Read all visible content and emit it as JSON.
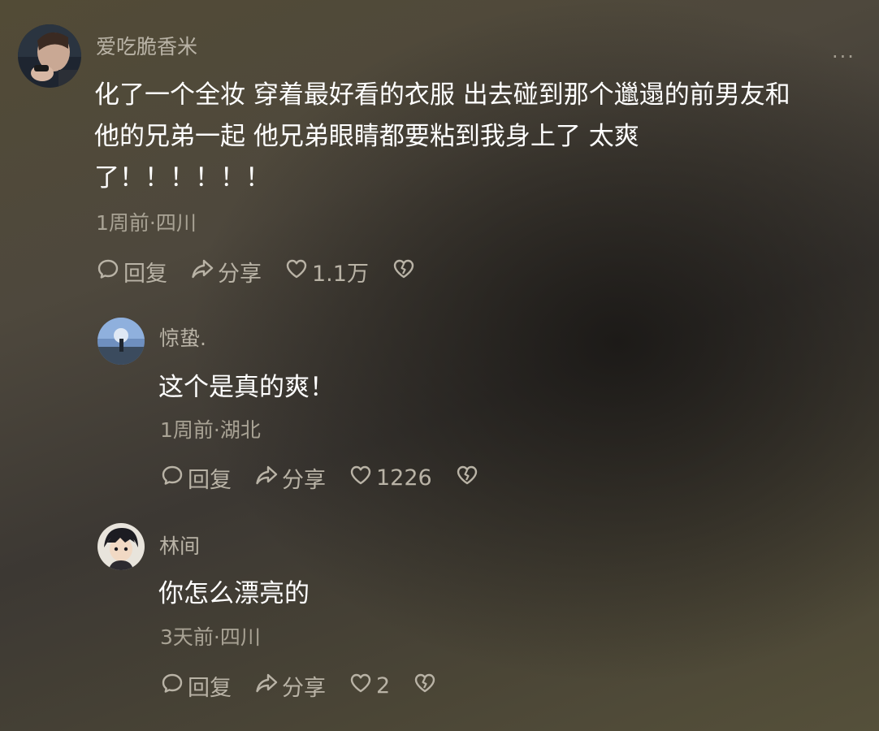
{
  "comments": [
    {
      "username": "爱吃脆香米",
      "text_lines": [
        "化了一个全妆 穿着最好看的衣服 出去碰到那个邋遢的前男友和",
        "他的兄弟一起 他兄弟眼睛都要粘到我身上了 太爽",
        "了！！！！！！"
      ],
      "meta": "1周前·四川",
      "reply_label": "回复",
      "share_label": "分享",
      "like_count": "1.1万",
      "more_label": "···"
    },
    {
      "username": "惊蛰.",
      "text_lines": [
        "这个是真的爽！"
      ],
      "meta": "1周前·湖北",
      "reply_label": "回复",
      "share_label": "分享",
      "like_count": "1226"
    },
    {
      "username": "林间",
      "text_lines": [
        "你怎么漂亮的"
      ],
      "meta": "3天前·四川",
      "reply_label": "回复",
      "share_label": "分享",
      "like_count": "2"
    }
  ],
  "icons": {
    "reply": "comment-bubble-icon",
    "share": "share-arrow-icon",
    "like": "heart-outline-icon",
    "dislike": "broken-heart-icon",
    "more": "more-dots-icon"
  },
  "colors": {
    "text_primary": "#ffffff",
    "text_secondary": "#b9b3a6",
    "meta": "#a9a395"
  }
}
